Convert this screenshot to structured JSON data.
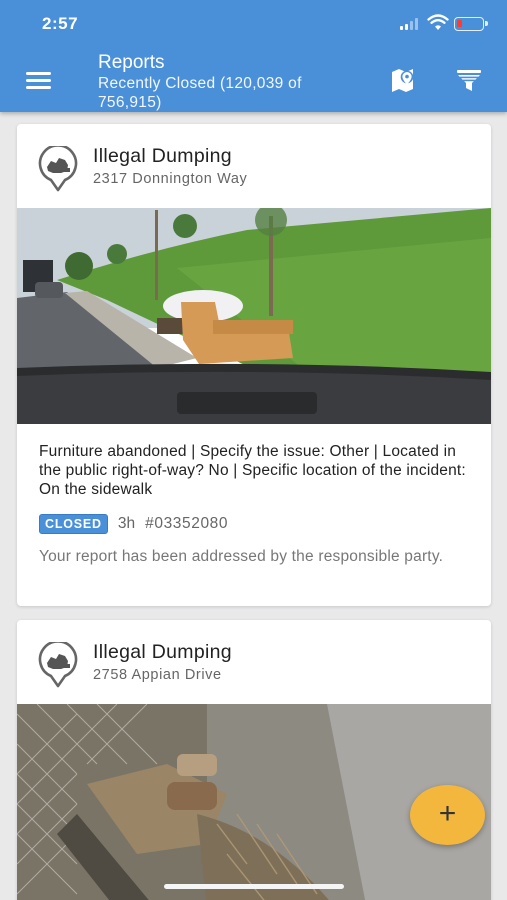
{
  "status_bar": {
    "time": "2:57"
  },
  "header": {
    "title": "Reports",
    "subtitle": "Recently Closed (120,039 of 756,915)",
    "menu_icon": "hamburger-menu-icon",
    "map_icon": "map-pin-icon",
    "filter_icon": "filter-icon"
  },
  "reports": [
    {
      "category": "Illegal Dumping",
      "address": "2317 Donnington Way",
      "description": "Furniture abandoned | Specify the issue: Other | Located in the public right-of-way? No | Specific location of the incident: On the sidewalk",
      "status": "CLOSED",
      "age": "3h",
      "report_id": "#03352080",
      "resolution": "Your report has been addressed by the responsible party."
    },
    {
      "category": "Illegal Dumping",
      "address": "2758 Appian Drive"
    }
  ],
  "fab": {
    "label": "+"
  },
  "colors": {
    "header_bg": "#4a90d9",
    "badge_bg": "#4a90d9",
    "fab_bg": "#f3b73d",
    "battery_low": "#ff3b30"
  }
}
